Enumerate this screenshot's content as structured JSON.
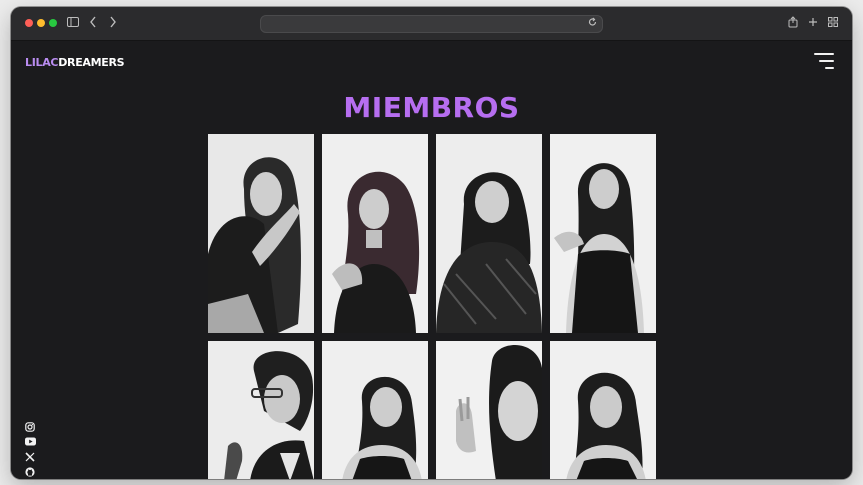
{
  "browser": {
    "sidebar_icon": "sidebar-icon",
    "back_icon": "chevron-left-icon",
    "forward_icon": "chevron-right-icon",
    "reload_icon": "reload-icon",
    "share_icon": "share-icon",
    "new_tab_icon": "plus-icon",
    "tabs_icon": "tab-overview-icon"
  },
  "site": {
    "logo_part1": "LILAC",
    "logo_part2": "DREAMERS",
    "menu_icon": "hamburger-menu-icon",
    "title": "MIEMBROS",
    "accent_color": "#b66ef0",
    "logo_accent_color": "#b98cf0"
  },
  "members": {
    "photo_count": 8
  },
  "social": [
    {
      "icon": "instagram-icon"
    },
    {
      "icon": "youtube-icon"
    },
    {
      "icon": "x-icon"
    },
    {
      "icon": "github-icon"
    }
  ]
}
